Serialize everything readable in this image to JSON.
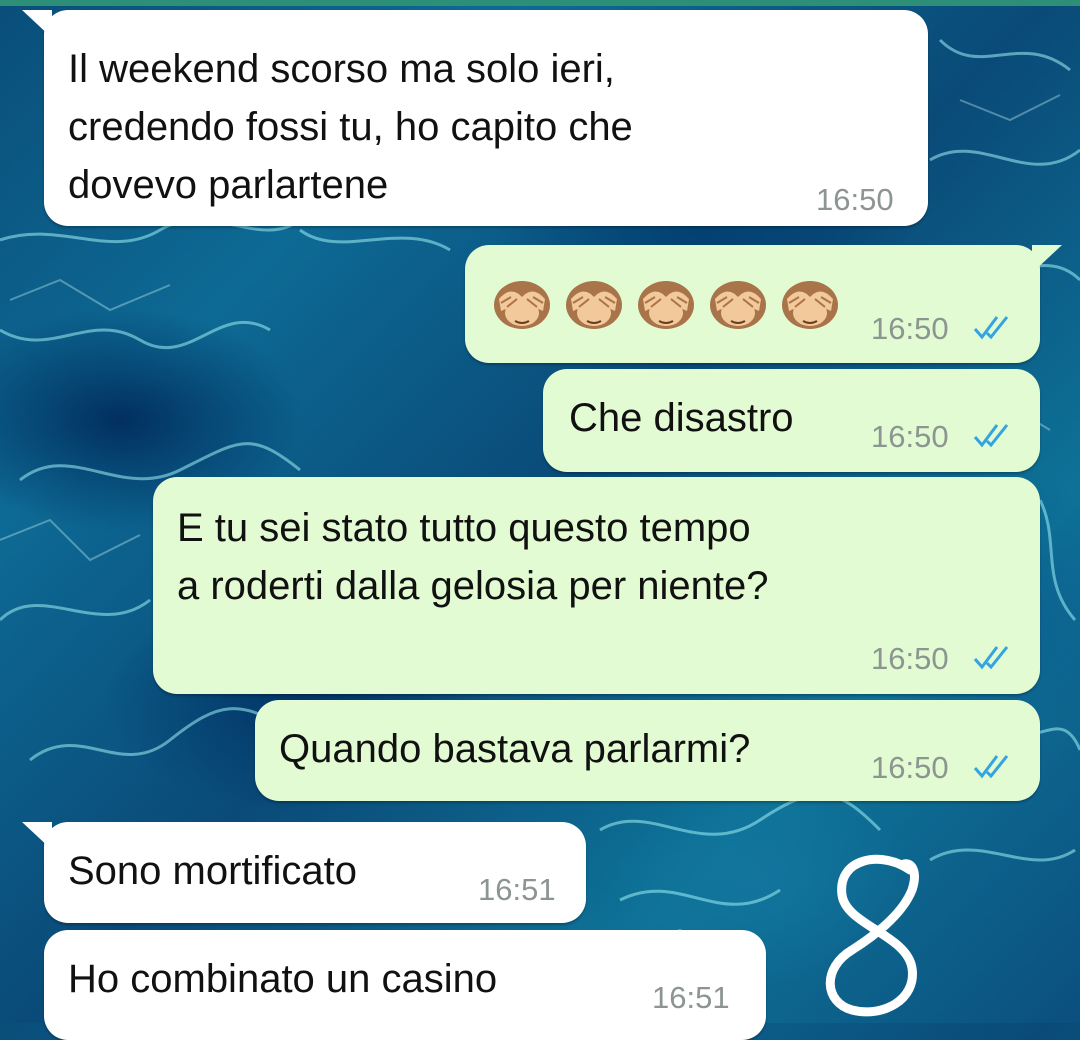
{
  "messages": [
    {
      "direction": "incoming",
      "text": "Il weekend scorso ma solo ieri,\ncredendo fossi tu, ho capito che\ndovevo parlartene",
      "time": "16:50"
    },
    {
      "direction": "outgoing",
      "emoji": [
        "see-no-evil-monkey",
        "see-no-evil-monkey",
        "see-no-evil-monkey",
        "see-no-evil-monkey",
        "see-no-evil-monkey"
      ],
      "time": "16:50",
      "status": "read"
    },
    {
      "direction": "outgoing",
      "text": "Che disastro",
      "time": "16:50",
      "status": "read"
    },
    {
      "direction": "outgoing",
      "text": "E tu sei stato tutto questo tempo\na roderti dalla gelosia per niente?",
      "time": "16:50",
      "status": "read"
    },
    {
      "direction": "outgoing",
      "text": "Quando bastava parlarmi?",
      "time": "16:50",
      "status": "read"
    },
    {
      "direction": "incoming",
      "text": "Sono mortificato",
      "time": "16:51"
    },
    {
      "direction": "incoming",
      "text": "Ho combinato un casino",
      "time": "16:51"
    }
  ],
  "annotation": "8",
  "colors": {
    "incoming_bubble": "#ffffff",
    "outgoing_bubble": "#e2fbd3",
    "read_ticks": "#34a4e0",
    "timestamp": "#8c9590",
    "header_strip": "#2e8f78"
  }
}
